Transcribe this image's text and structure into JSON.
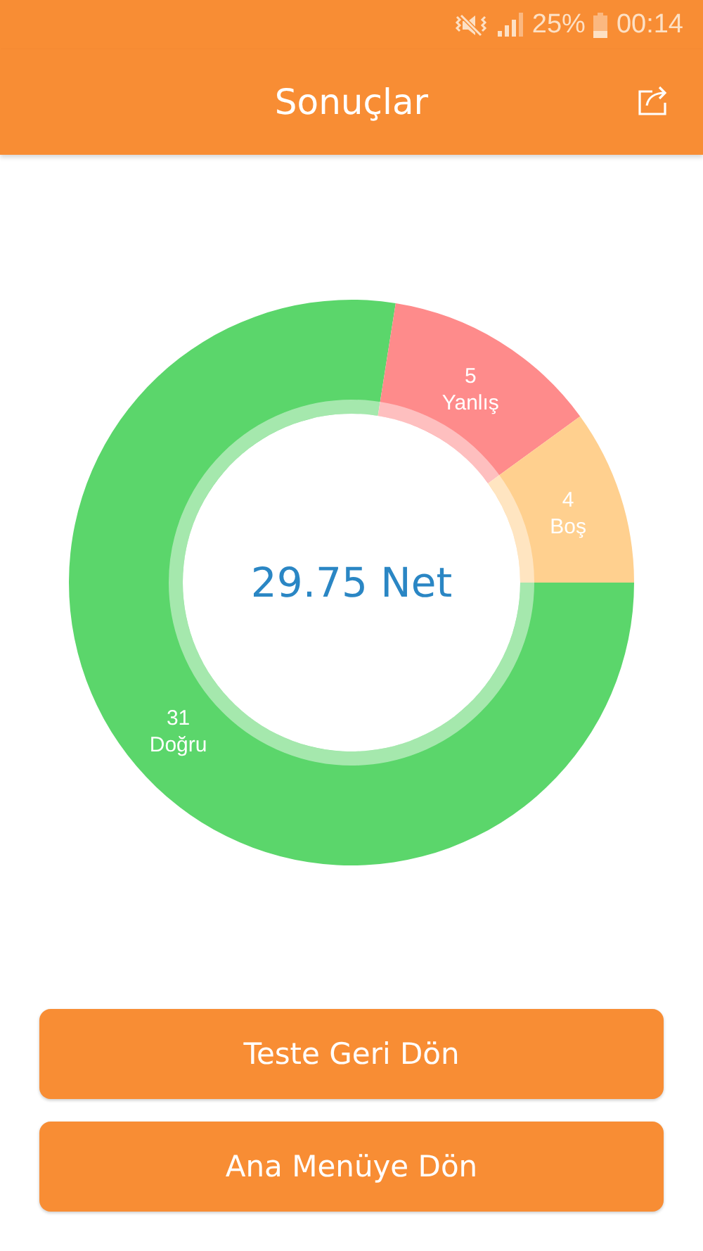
{
  "status_bar": {
    "battery": "25%",
    "time": "00:14"
  },
  "header": {
    "title": "Sonuçlar"
  },
  "result": {
    "net": "29.75 Net",
    "chart_data": {
      "type": "donut",
      "categories": [
        "Doğru",
        "Yanlış",
        "Boş"
      ],
      "values": [
        31,
        5,
        4
      ],
      "colors": [
        "#5bd66b",
        "#fe8b8b",
        "#ffd08f"
      ],
      "data_labels": true
    }
  },
  "buttons": [
    "Teste Geri Dön",
    "Ana Menüye Dön"
  ]
}
